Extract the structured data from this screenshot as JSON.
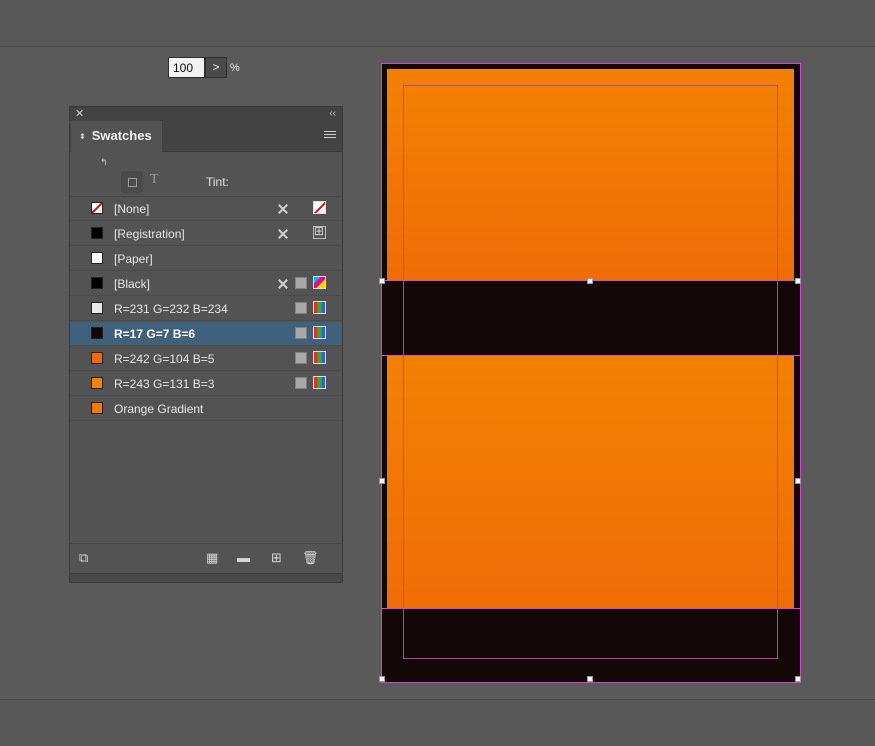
{
  "panel": {
    "tab_title": "Swatches",
    "tint_label": "Tint:",
    "tint_value": "100",
    "tint_step": ">",
    "tint_unit": "%"
  },
  "swatches": [
    {
      "label": "[None]",
      "chip": "none",
      "noedit": true,
      "process": false,
      "mode": "none-box"
    },
    {
      "label": "[Registration]",
      "chip": "#000000",
      "noedit": true,
      "process": false,
      "mode": "registration"
    },
    {
      "label": "[Paper]",
      "chip": "#ffffff",
      "noedit": false,
      "process": false,
      "mode": ""
    },
    {
      "label": "[Black]",
      "chip": "#000000",
      "noedit": true,
      "process": true,
      "mode": "cmyk"
    },
    {
      "label": "R=231 G=232 B=234",
      "chip": "#e7e8ea",
      "noedit": false,
      "process": true,
      "mode": "rgb"
    },
    {
      "label": "R=17 G=7 B=6",
      "chip": "#110706",
      "noedit": false,
      "process": true,
      "mode": "rgb",
      "selected": true
    },
    {
      "label": "R=242 G=104 B=5",
      "chip": "#f26805",
      "noedit": false,
      "process": true,
      "mode": "rgb"
    },
    {
      "label": "R=243 G=131 B=3",
      "chip": "#f38303",
      "noedit": false,
      "process": true,
      "mode": "rgb"
    },
    {
      "label": "Orange Gradient",
      "chip": "#f27a04",
      "noedit": false,
      "process": false,
      "mode": ""
    }
  ],
  "colors": {
    "selection_row": "#40617c",
    "orange_top": "#f38104",
    "orange_bottom": "#f06c06",
    "dark": "#130707",
    "guide": "#b04aa0"
  }
}
